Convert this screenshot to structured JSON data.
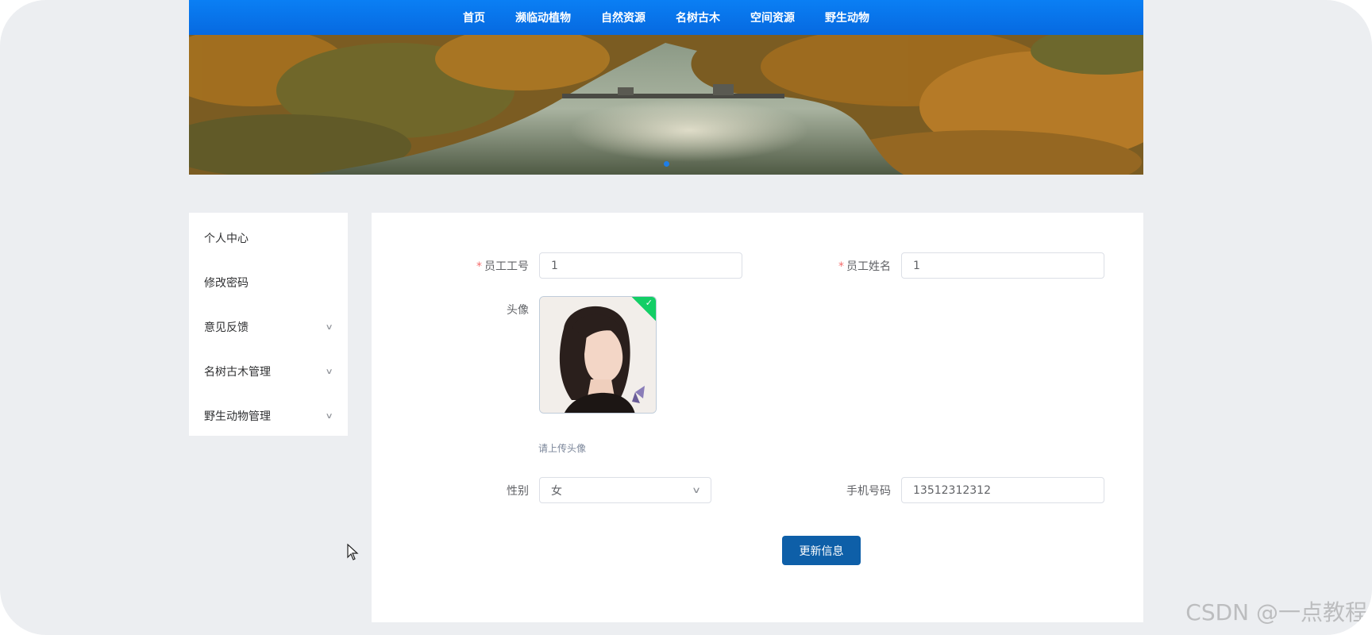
{
  "nav": {
    "items": [
      "首页",
      "濒临动植物",
      "自然资源",
      "名树古木",
      "空间资源",
      "野生动物"
    ]
  },
  "banner": {
    "description_icon": "landscape-image",
    "dots": 1,
    "active_dot": 0
  },
  "sidebar": {
    "items": [
      {
        "label": "个人中心",
        "expandable": false
      },
      {
        "label": "修改密码",
        "expandable": false
      },
      {
        "label": "意见反馈",
        "expandable": true
      },
      {
        "label": "名树古木管理",
        "expandable": true
      },
      {
        "label": "野生动物管理",
        "expandable": true
      }
    ]
  },
  "form": {
    "employee_id_label": "员工工号",
    "employee_id_value": "1",
    "employee_name_label": "员工姓名",
    "employee_name_value": "1",
    "avatar_label": "头像",
    "avatar_tip": "请上传头像",
    "gender_label": "性别",
    "gender_value": "女",
    "phone_label": "手机号码",
    "phone_value": "13512312312",
    "submit_label": "更新信息"
  },
  "watermark": "CSDN @一点教程",
  "colors": {
    "nav_bg": "#0a7ff4",
    "button_bg": "#0e5fa8",
    "required": "#f56c6c",
    "success": "#13ce66"
  }
}
